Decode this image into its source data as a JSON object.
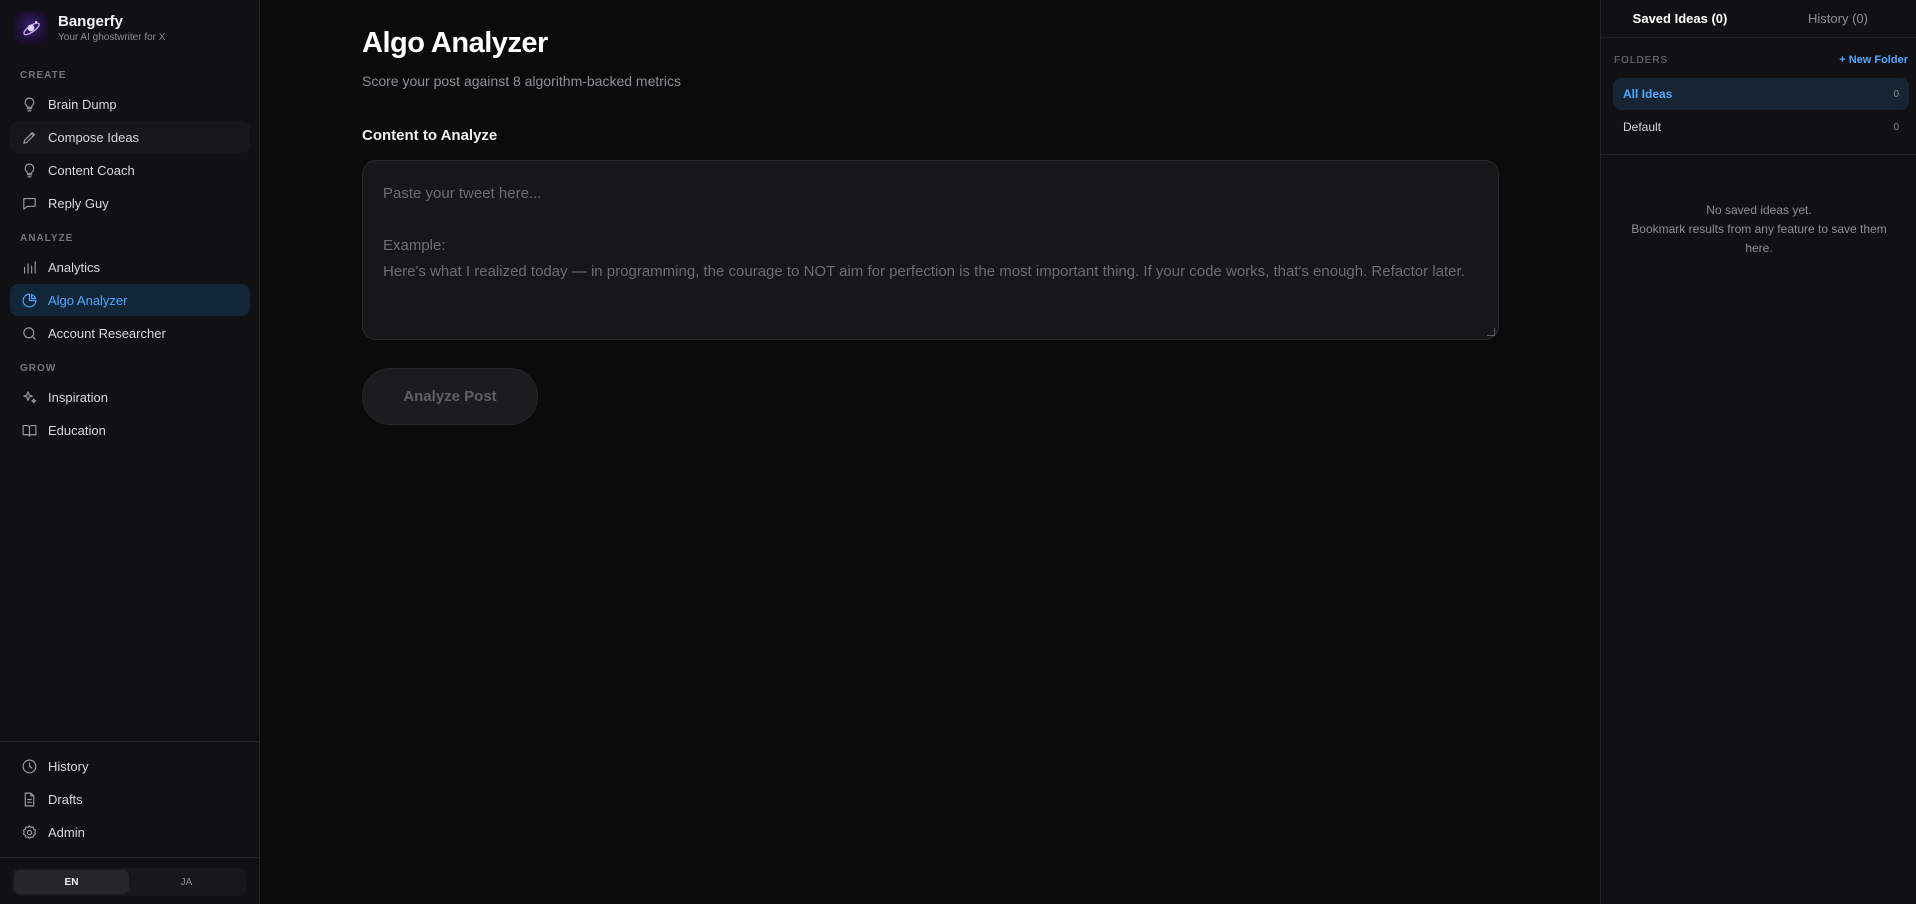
{
  "brand": {
    "name": "Bangerfy",
    "tagline": "Your AI ghostwriter for X"
  },
  "sidebar": {
    "sections": [
      {
        "label": "CREATE",
        "items": [
          {
            "label": "Brain Dump",
            "icon": "lightbulb-icon"
          },
          {
            "label": "Compose Ideas",
            "icon": "pencil-icon"
          },
          {
            "label": "Content Coach",
            "icon": "bulb-icon"
          },
          {
            "label": "Reply Guy",
            "icon": "chat-icon"
          }
        ]
      },
      {
        "label": "ANALYZE",
        "items": [
          {
            "label": "Analytics",
            "icon": "bar-chart-icon"
          },
          {
            "label": "Algo Analyzer",
            "icon": "pie-chart-icon",
            "active": true
          },
          {
            "label": "Account Researcher",
            "icon": "search-icon"
          }
        ]
      },
      {
        "label": "GROW",
        "items": [
          {
            "label": "Inspiration",
            "icon": "sparkles-icon"
          },
          {
            "label": "Education",
            "icon": "book-icon"
          }
        ]
      }
    ],
    "footer_items": [
      {
        "label": "History",
        "icon": "clock-icon"
      },
      {
        "label": "Drafts",
        "icon": "document-icon"
      },
      {
        "label": "Admin",
        "icon": "gear-icon"
      }
    ],
    "languages": [
      "EN",
      "JA"
    ],
    "active_language": "EN"
  },
  "main": {
    "title": "Algo Analyzer",
    "subtitle": "Score your post against 8 algorithm-backed metrics",
    "field_label": "Content to Analyze",
    "textarea_placeholder": "Paste your tweet here...\n\nExample:\nHere's what I realized today — in programming, the courage to NOT aim for perfection is the most important thing. If your code works, that's enough. Refactor later.",
    "analyze_button": "Analyze Post"
  },
  "right_panel": {
    "tabs": [
      "Saved Ideas (0)",
      "History (0)"
    ],
    "folders_label": "FOLDERS",
    "new_folder": "+ New Folder",
    "folders": [
      {
        "name": "All Ideas",
        "count": "0",
        "active": true
      },
      {
        "name": "Default",
        "count": "0"
      }
    ],
    "empty_title": "No saved ideas yet.",
    "empty_hint": "Bookmark results from any feature to save them here."
  },
  "colors": {
    "accent": "#4fa8ff",
    "active_bg": "#12263a",
    "background": "#0b0b0c"
  }
}
